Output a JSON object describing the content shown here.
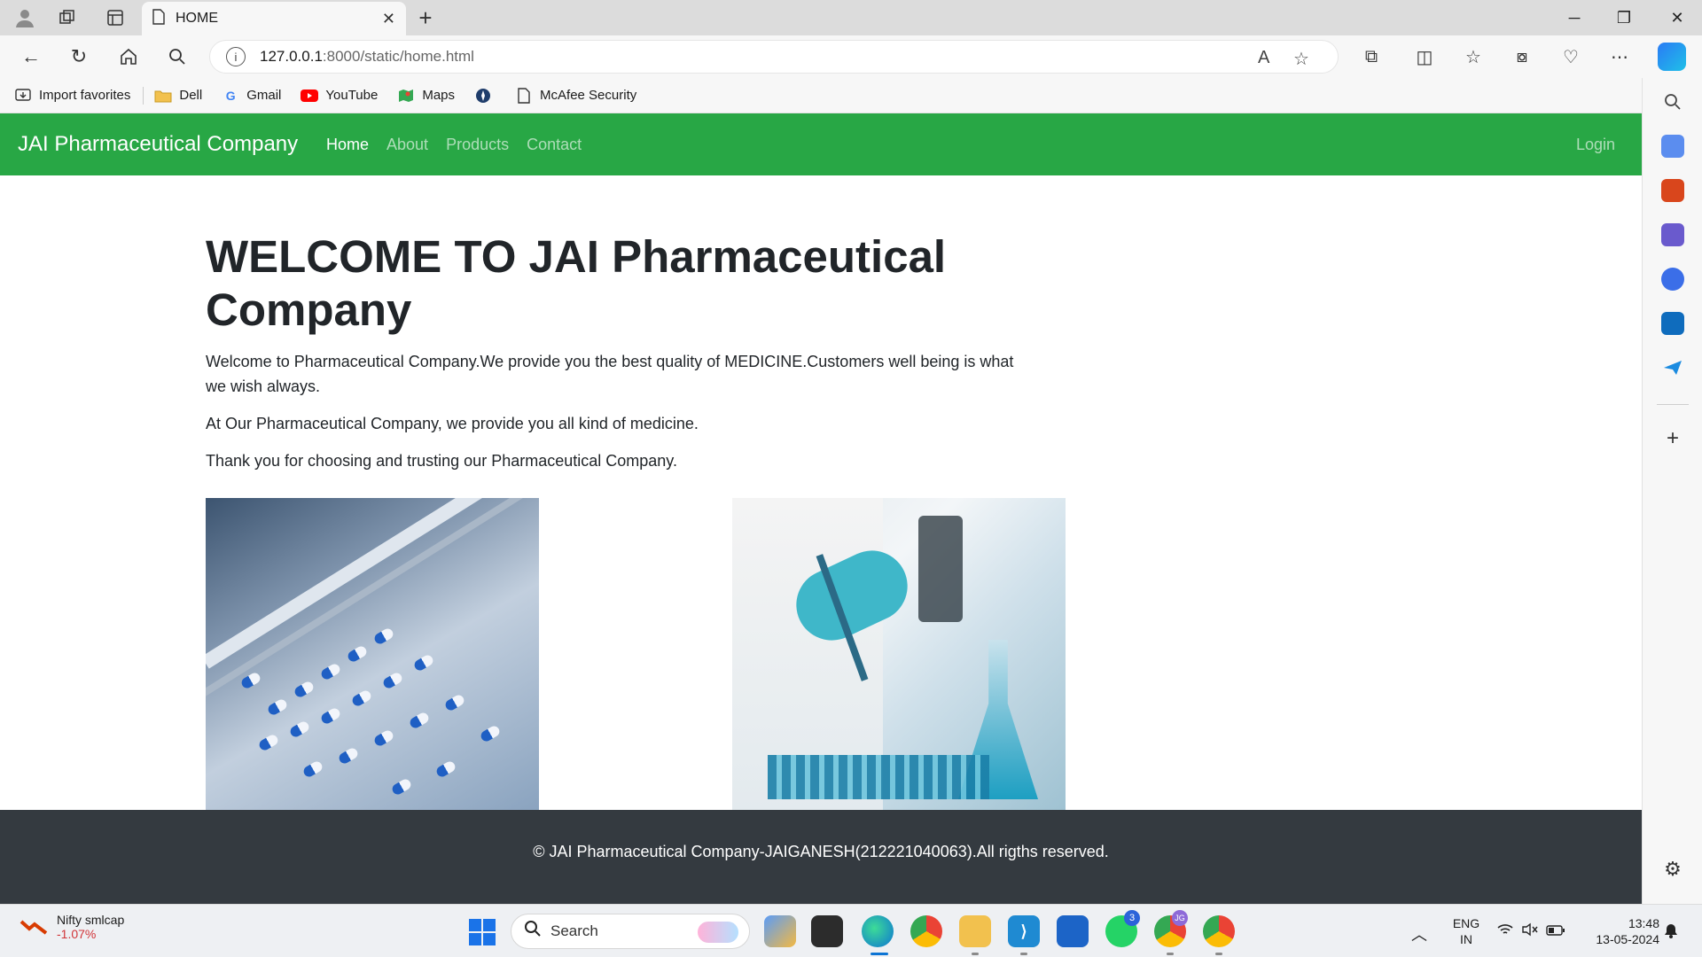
{
  "browser": {
    "tab_title": "HOME",
    "url_host": "127.0.0.1",
    "url_rest": ":8000/static/home.html",
    "favorites": [
      {
        "label": "Import favorites",
        "icon": "import-icon"
      },
      {
        "label": "Dell",
        "icon": "folder-icon"
      },
      {
        "label": "Gmail",
        "icon": "google-icon"
      },
      {
        "label": "YouTube",
        "icon": "youtube-icon"
      },
      {
        "label": "Maps",
        "icon": "maps-icon"
      },
      {
        "label": "",
        "icon": "compass-icon"
      },
      {
        "label": "McAfee Security",
        "icon": "page-icon"
      }
    ]
  },
  "site": {
    "brand": "JAI Pharmaceutical Company",
    "nav": [
      "Home",
      "About",
      "Products",
      "Contact"
    ],
    "login": "Login",
    "heading": "WELCOME TO JAI Pharmaceutical Company",
    "paragraphs": [
      "Welcome to Pharmaceutical Company.We provide you the best quality of MEDICINE.Customers well being is what we wish always.",
      "At Our Pharmaceutical Company, we provide you all kind of medicine.",
      "Thank you for choosing and trusting our Pharmaceutical Company."
    ],
    "footer": "© JAI Pharmaceutical Company-JAIGANESH(212221040063).All rigths reserved.",
    "colors": {
      "navbar": "#28a745",
      "footer": "#343a40"
    }
  },
  "taskbar": {
    "ticker_name": "Nifty smlcap",
    "ticker_value": "-1.07%",
    "search_label": "Search",
    "whatsapp_badge": "3",
    "chrome_badge": "JG",
    "lang_top": "ENG",
    "lang_bottom": "IN",
    "time": "13:48",
    "date": "13-05-2024"
  }
}
